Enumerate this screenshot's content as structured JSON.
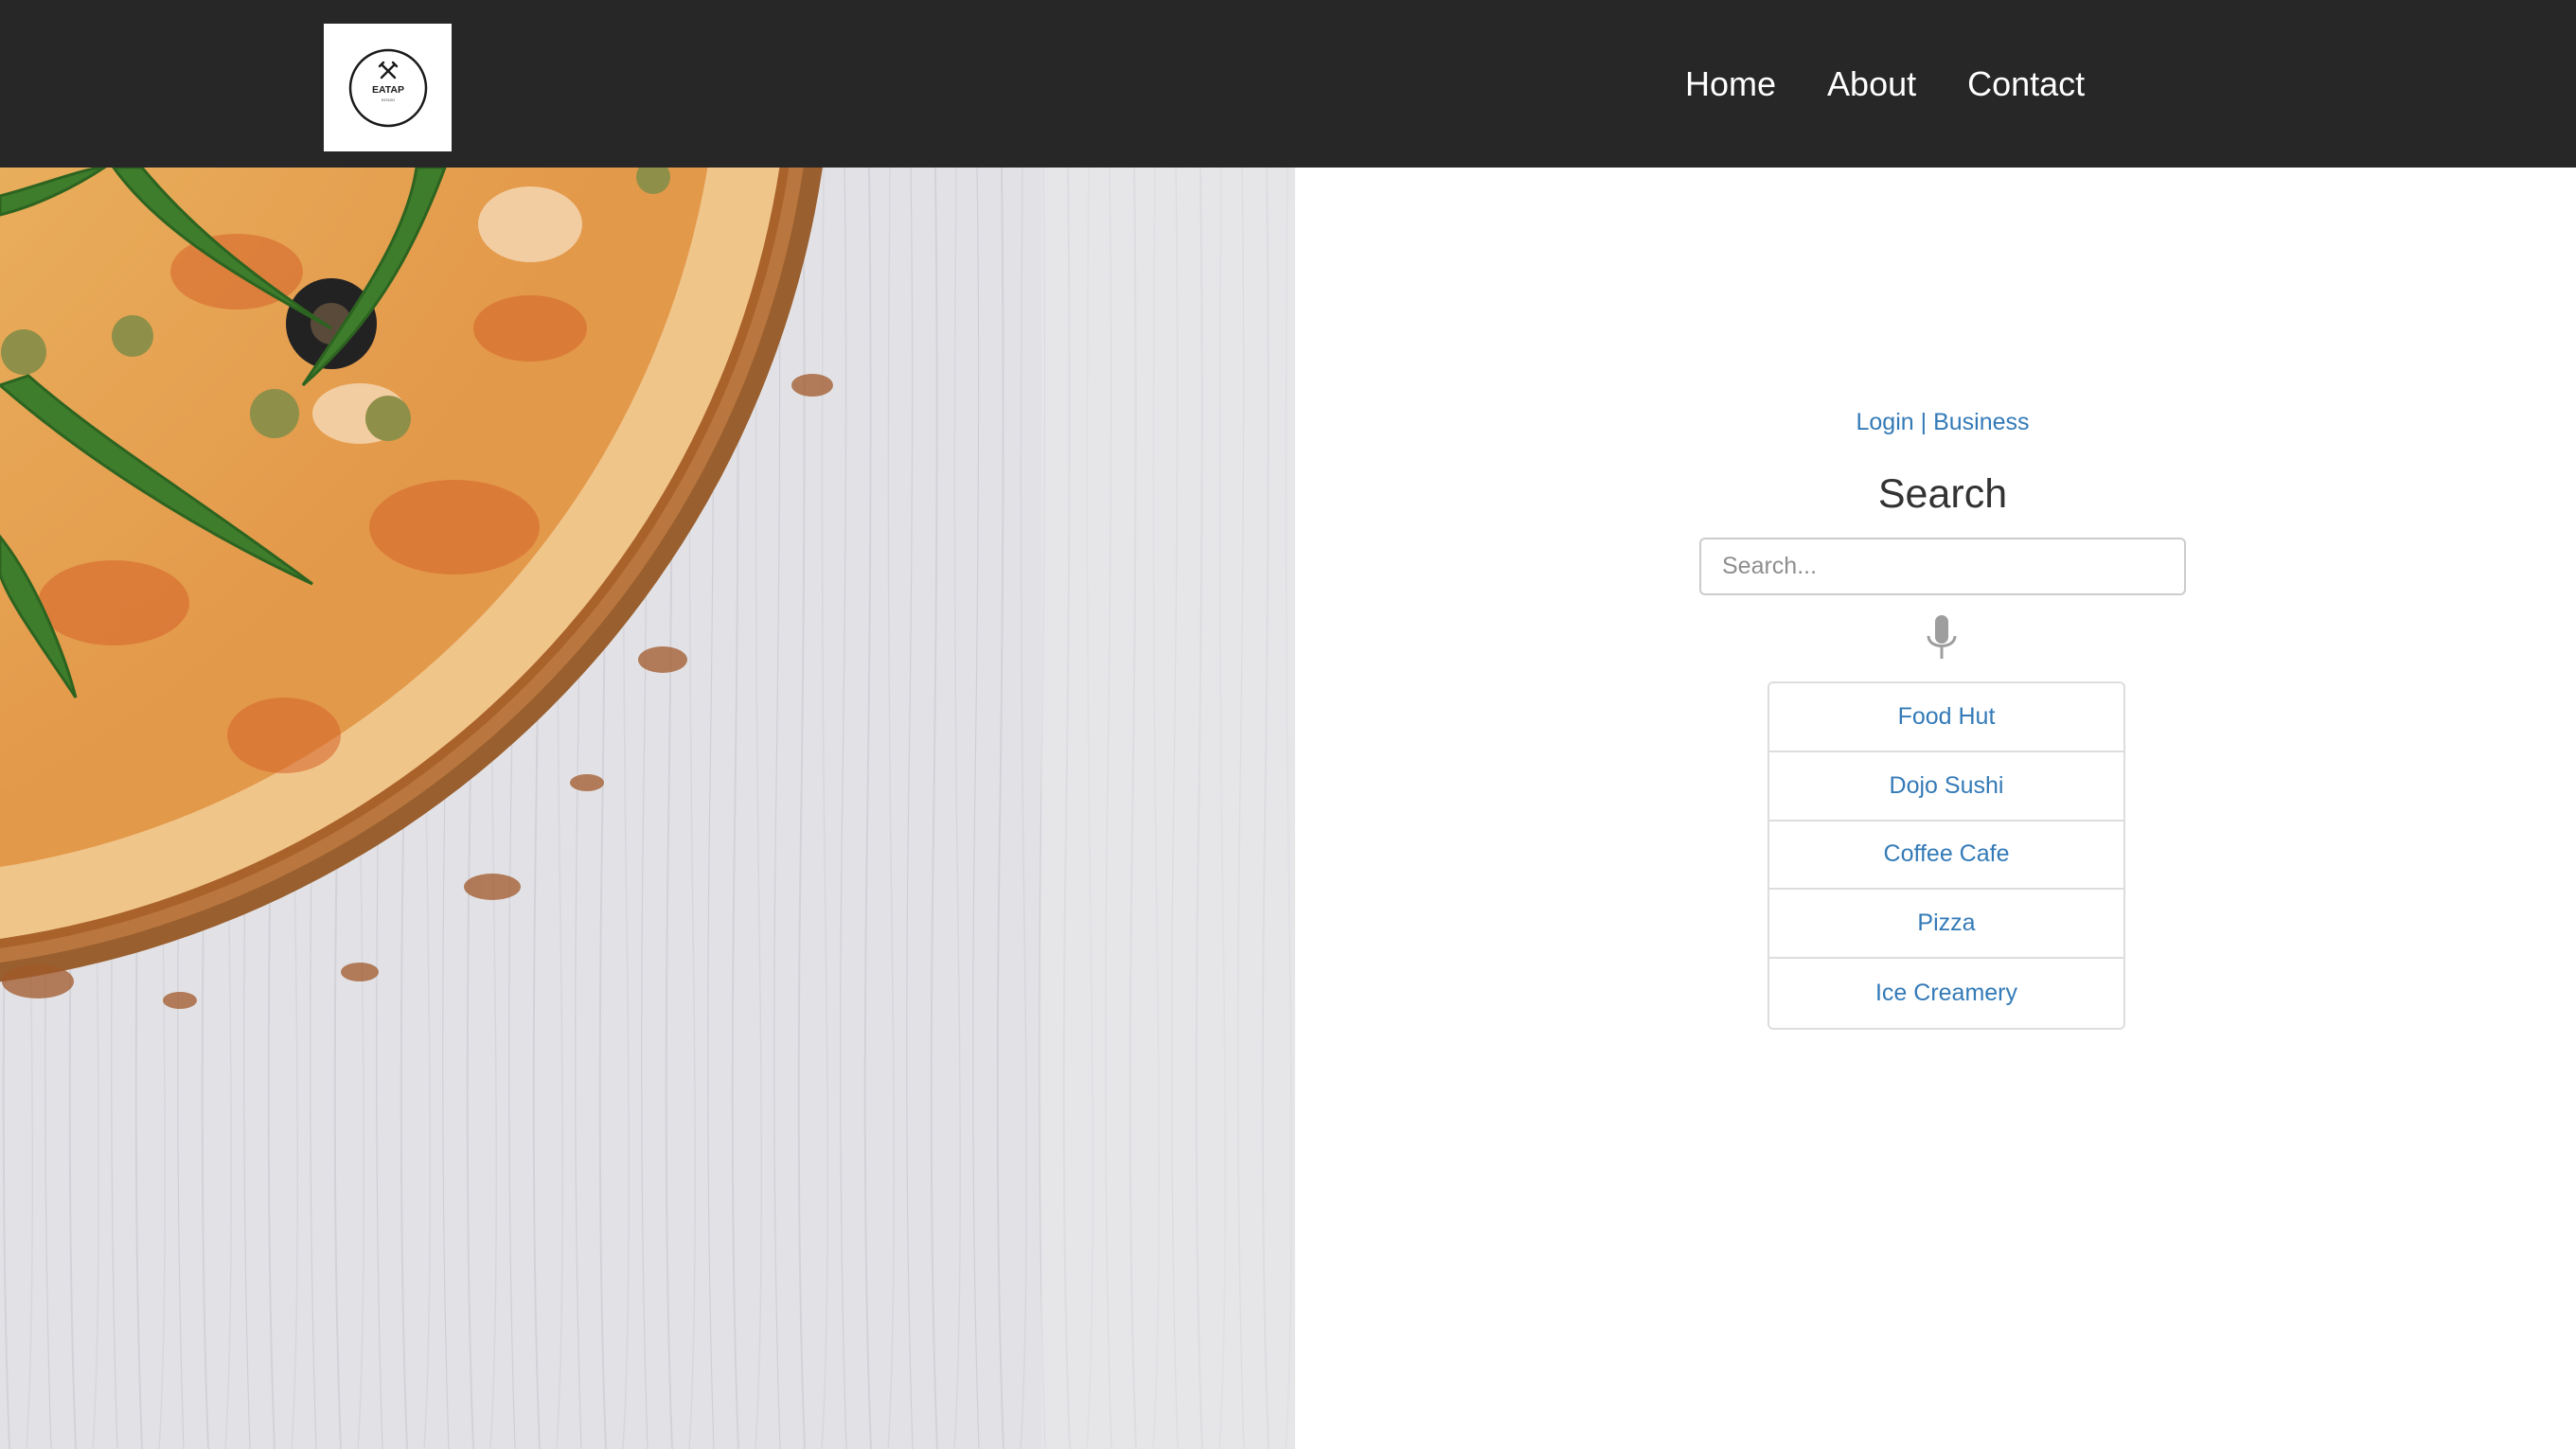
{
  "header": {
    "logo": {
      "text": "EATAP",
      "subtext": "EAT&GO",
      "icon": "fork-knife-icon"
    },
    "nav": [
      "Home",
      "About",
      "Contact"
    ]
  },
  "hero_image": {
    "description_icon": "pizza-photo"
  },
  "auth_links": {
    "login": "Login",
    "separator": "|",
    "business": "Business"
  },
  "search": {
    "title": "Search",
    "placeholder": "Search...",
    "voice_icon": "microphone-icon"
  },
  "results": [
    "Food Hut",
    "Dojo Sushi",
    "Coffee Cafe",
    "Pizza",
    "Ice Creamery"
  ],
  "colors": {
    "header_bg": "#272727",
    "link": "#337ab7",
    "title": "#333333",
    "border": "#dddddd"
  }
}
